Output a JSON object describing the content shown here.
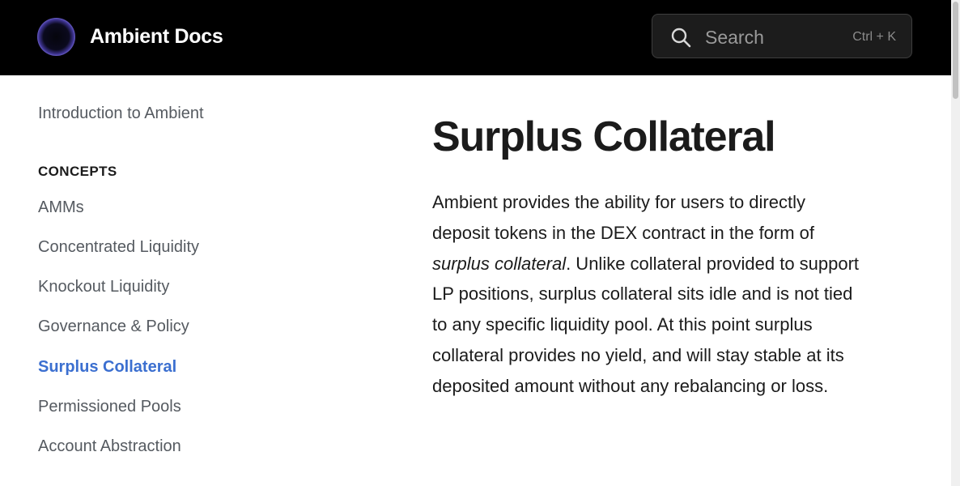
{
  "header": {
    "brand": "Ambient Docs",
    "search": {
      "placeholder": "Search",
      "shortcut": "Ctrl + K"
    }
  },
  "sidebar": {
    "intro_link": "Introduction to Ambient",
    "section_title": "CONCEPTS",
    "items": [
      {
        "label": "AMMs",
        "active": false
      },
      {
        "label": "Concentrated Liquidity",
        "active": false
      },
      {
        "label": "Knockout Liquidity",
        "active": false
      },
      {
        "label": "Governance & Policy",
        "active": false
      },
      {
        "label": "Surplus Collateral",
        "active": true
      },
      {
        "label": "Permissioned Pools",
        "active": false
      },
      {
        "label": "Account Abstraction",
        "active": false
      }
    ]
  },
  "main": {
    "title": "Surplus Collateral",
    "paragraph": {
      "before": "Ambient provides the ability for users to directly deposit tokens in the DEX contract in the form of ",
      "emphasis": "surplus collateral",
      "after": ". Unlike collateral provided to support LP positions, surplus collateral sits idle and is not tied to any specific liquidity pool. At this point surplus collateral provides no yield, and will stay stable at its deposited amount without any rebalancing or loss."
    }
  },
  "colors": {
    "header_bg": "#000000",
    "active_link": "#3b6fd0",
    "nav_text": "#555a60",
    "body_text": "#1b1b1b"
  },
  "icons": {
    "logo": "ambient-logo-icon",
    "search": "search-icon"
  }
}
